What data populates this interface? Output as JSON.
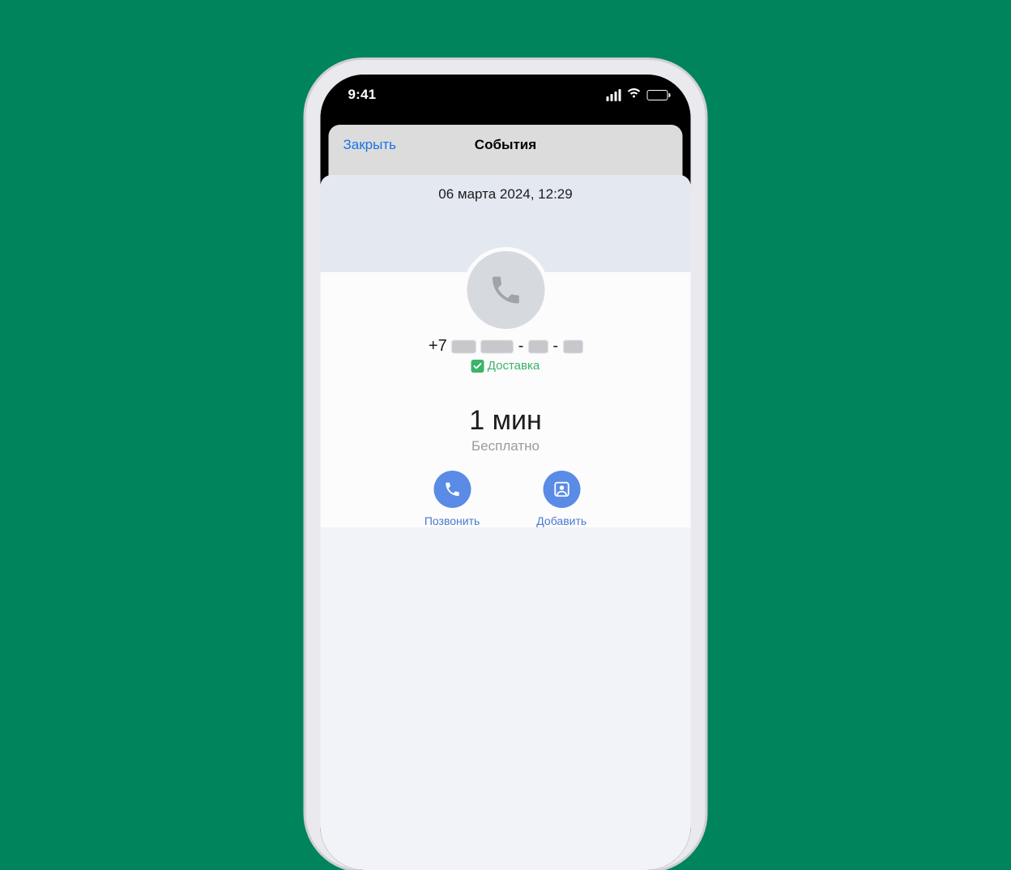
{
  "status": {
    "time": "9:41"
  },
  "nav": {
    "close": "Закрыть",
    "title": "События"
  },
  "event": {
    "datetime": "06 марта 2024, 12:29",
    "phone_prefix": "+7",
    "tag_label": "Доставка",
    "duration": "1 мин",
    "cost": "Бесплатно"
  },
  "actions": {
    "call": "Позвонить",
    "add": "Добавить"
  }
}
